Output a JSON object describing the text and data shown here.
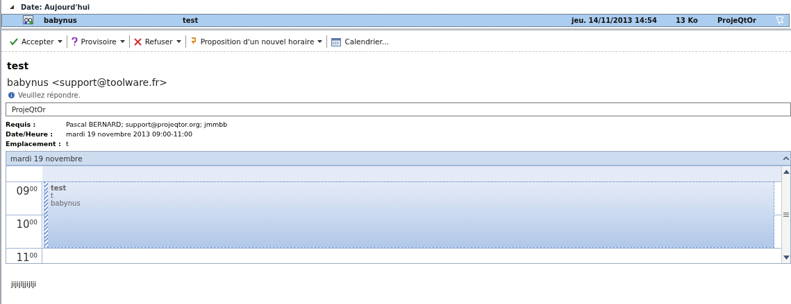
{
  "group": {
    "label": "Date: Aujourd'hui",
    "expanded": true
  },
  "messages": [
    {
      "from": "babynus",
      "subject": "test",
      "received": "jeu. 14/11/2013 14:54",
      "size": "13 Ko",
      "category": "ProjeQtOr",
      "selected": true
    }
  ],
  "toolbar": [
    {
      "kind": "accept",
      "label": "Accepter",
      "dropdown": true
    },
    {
      "kind": "tentative",
      "label": "Provisoire",
      "dropdown": true
    },
    {
      "kind": "decline",
      "label": "Refuser",
      "dropdown": true
    },
    {
      "kind": "propose",
      "label": "Proposition d'un nouvel horaire",
      "dropdown": true
    },
    {
      "kind": "calendar",
      "label": "Calendrier...",
      "dropdown": false
    }
  ],
  "title": "test",
  "sender": "babynus <support@toolware.fr>",
  "notice": "Veuillez répondre.",
  "category": "ProjeQtOr",
  "fields": [
    {
      "label": "Requis :",
      "value": "Pascal BERNARD; support@projeqtor.org; jmmbb"
    },
    {
      "label": "Date/Heure :",
      "value": "mardi 19 novembre 2013 09:00-11:00"
    },
    {
      "label": "Emplacement :",
      "value": "t"
    }
  ],
  "calendar": {
    "date_header": "mardi 19 novembre",
    "hours": [
      {
        "hour": "09",
        "minutes": "00"
      },
      {
        "hour": "10",
        "minutes": "00"
      },
      {
        "hour": "11",
        "minutes": "00"
      }
    ],
    "event": {
      "title": "test",
      "location": "t",
      "organizer": "babynus"
    }
  },
  "body": "jijijljjijlji"
}
